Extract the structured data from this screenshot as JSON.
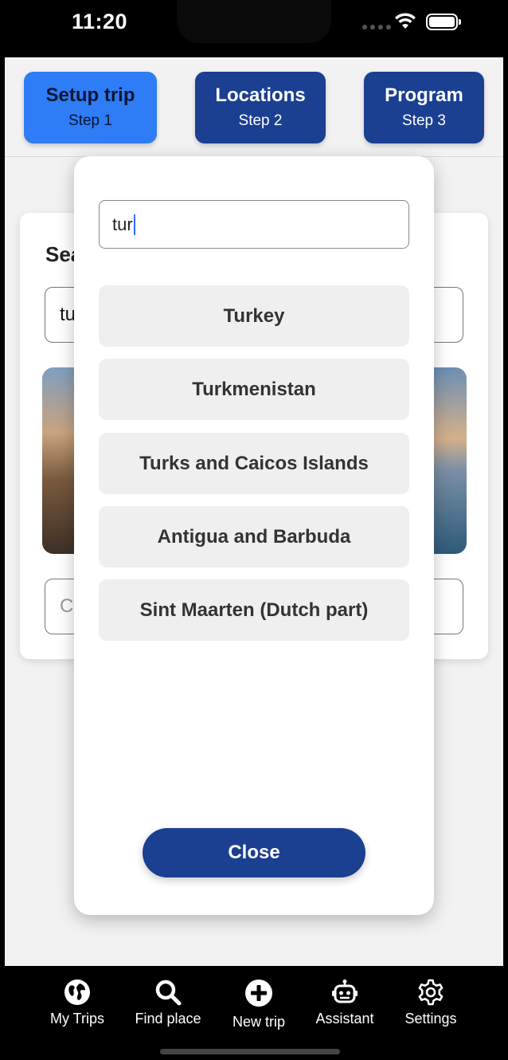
{
  "status_bar": {
    "time": "11:20"
  },
  "steps": [
    {
      "title": "Setup trip",
      "subtitle": "Step 1",
      "active": true
    },
    {
      "title": "Locations",
      "subtitle": "Step 2",
      "active": false
    },
    {
      "title": "Program",
      "subtitle": "Step 3",
      "active": false
    }
  ],
  "background_card": {
    "title_visible": "Sea",
    "search_value_visible": "tu",
    "second_input_visible": "C"
  },
  "modal": {
    "search_value": "tur",
    "options": [
      "Turkey",
      "Turkmenistan",
      "Turks and Caicos Islands",
      "Antigua and Barbuda",
      "Sint Maarten (Dutch part)"
    ],
    "close_label": "Close"
  },
  "tab_bar": {
    "items": [
      {
        "label": "My Trips",
        "icon": "globe-icon"
      },
      {
        "label": "Find place",
        "icon": "search-icon"
      },
      {
        "label": "New trip",
        "icon": "plus-circle-icon"
      },
      {
        "label": "Assistant",
        "icon": "robot-icon"
      },
      {
        "label": "Settings",
        "icon": "gear-icon"
      }
    ]
  },
  "colors": {
    "primary": "#1b3f91",
    "active_step": "#2e7cf6",
    "caret": "#2f6bff"
  }
}
